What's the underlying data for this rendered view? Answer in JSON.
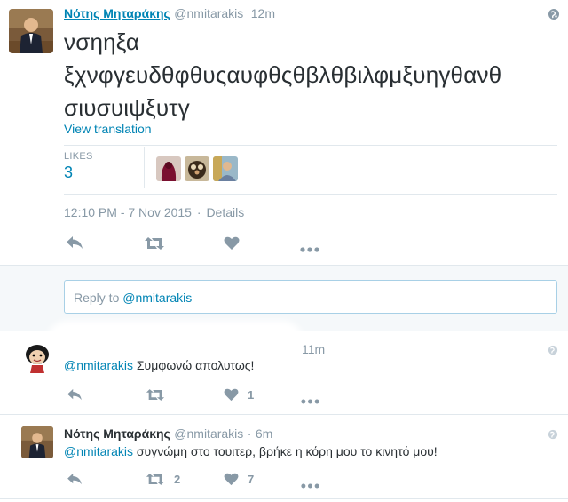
{
  "main_tweet": {
    "author_name": "Νότης Μηταράκης",
    "handle": "@nmitarakis",
    "age": "12m",
    "text_lines": [
      "νσηηξα",
      "ξχνφγευδθφθυςαυφθςθβλθβιλφμξυηγθανθ",
      "σιυσυιψξυτγ"
    ],
    "view_translation": "View translation",
    "likes_label": "LIKES",
    "likes_count": "3",
    "timestamp": "12:10 PM - 7 Nov 2015",
    "details_sep": "·",
    "details_label": "Details"
  },
  "reply_box": {
    "placeholder_prefix": "Reply to ",
    "placeholder_handle": "@nmitarakis"
  },
  "replies": [
    {
      "age": "11m",
      "mention": "@nmitarakis",
      "text": " Συμφωνώ απολυτως!",
      "like_count": "1"
    },
    {
      "author_name": "Νότης Μηταράκης",
      "handle": "@nmitarakis",
      "sep": "·",
      "age": "6m",
      "mention": "@nmitarakis",
      "text": " συγνώμη στο τουιτερ, βρήκε η κόρη μου το κινητό μου!",
      "retweet_count": "2",
      "like_count": "7"
    }
  ],
  "colors": {
    "link": "#0084b4",
    "icon_grey": "#8899a6",
    "divider": "#e1e8ed"
  },
  "icons": [
    "reply-icon",
    "retweet-icon",
    "heart-icon",
    "more-icon",
    "globe-icon"
  ]
}
